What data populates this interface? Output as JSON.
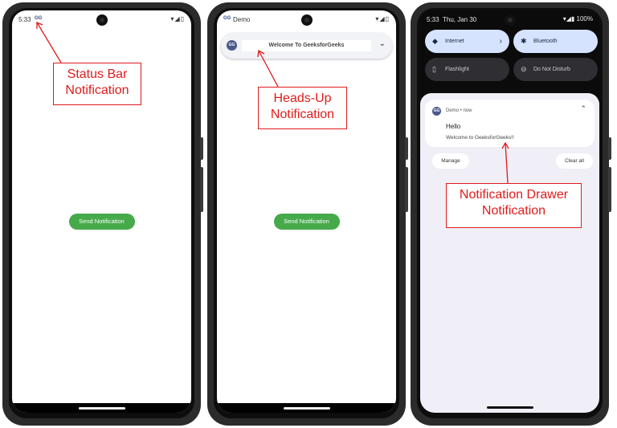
{
  "phone1": {
    "status_time": "5:33",
    "status_app_icon": "GG",
    "status_right": "▾◢▯",
    "send_button": "Send Notification"
  },
  "phone2": {
    "status_app_icon": "GG",
    "status_app_name": "Demo",
    "status_right": "▾◢▯",
    "headsup_logo": "GG",
    "headsup_title": "Welcome To GeeksforGeeks",
    "headsup_chevron": "⌄",
    "send_button": "Send Notification"
  },
  "phone3": {
    "status_time": "5:33",
    "status_date": "Thu, Jan 30",
    "status_right": "▾◢▮ 100%",
    "tiles": [
      {
        "label": "Internet",
        "icon": "wifi-icon",
        "glyph": "◆"
      },
      {
        "label": "Bluetooth",
        "icon": "bluetooth-icon",
        "glyph": "✱"
      },
      {
        "label": "Flashlight",
        "icon": "flashlight-icon",
        "glyph": "▯"
      },
      {
        "label": "Do Not Disturb",
        "icon": "dnd-icon",
        "glyph": "⊖"
      }
    ],
    "internet_chevron": "›",
    "notification": {
      "logo": "GG",
      "meta": "Demo • now",
      "title": "Hello",
      "text": "Welcome to GeeksforGeeks!!",
      "collapse": "⌃"
    },
    "manage_button": "Manage",
    "clear_all_button": "Clear all"
  },
  "annotations": {
    "status_bar": [
      "Status Bar",
      "Notification"
    ],
    "heads_up": [
      "Heads-Up",
      "Notification"
    ],
    "drawer": [
      "Notification Drawer",
      "Notification"
    ]
  },
  "colors": {
    "send_button": "#46a94a",
    "annotation_red": "#e01b1b",
    "tile_active": "#d6e3ff",
    "tile_inactive": "#2e2e33"
  }
}
